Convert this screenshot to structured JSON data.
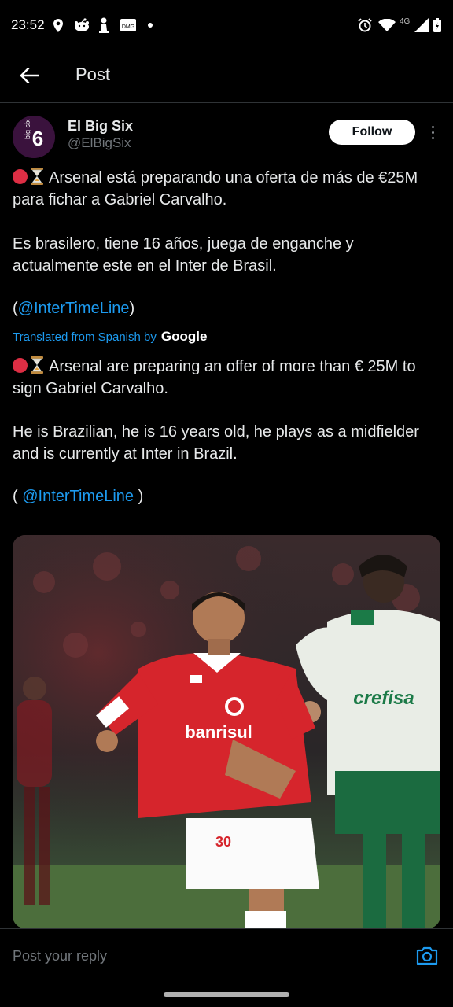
{
  "status_bar": {
    "time": "23:52",
    "network_label": "4G",
    "icons": [
      "location-icon",
      "reddit-icon",
      "chess-pawn-icon",
      "news-app-icon",
      "dot-icon",
      "alarm-icon",
      "wifi-icon",
      "signal-icon",
      "battery-icon"
    ]
  },
  "header": {
    "title": "Post",
    "back_icon": "arrow-left-icon"
  },
  "author": {
    "name": "El Big Six",
    "handle": "@ElBigSix",
    "avatar_text": "big six 6",
    "follow_label": "Follow",
    "more_icon": "more-vertical-icon"
  },
  "post": {
    "original_lines": {
      "p1": "Arsenal está preparando una oferta de más de €25M para fichar a Gabriel Carvalho.",
      "p2": "Es brasilero, tiene 16 años, juega de enganche y actualmente este en el Inter de Brasil.",
      "p3_open": "(",
      "p3_link": "@InterTimeLine",
      "p3_close": ")"
    },
    "translation_label": "Translated from Spanish by",
    "translation_provider": "Google",
    "translated_lines": {
      "p1": "Arsenal are preparing an offer of more than € 25M to sign Gabriel Carvalho.",
      "p2": "He is Brazilian, he is 16 years old, he plays as a midfielder and is currently at Inter in Brazil.",
      "p3_open": "( ",
      "p3_link": "@InterTimeLine",
      "p3_close": " )"
    },
    "emoji": [
      "red-circle-emoji",
      "hourglass-emoji"
    ],
    "media": {
      "type": "photo",
      "shirt_sponsor": "banrisul",
      "opponent_sponsor": "crefisa"
    }
  },
  "reply": {
    "placeholder": "Post your reply",
    "camera_icon": "camera-icon"
  },
  "colors": {
    "background": "#000000",
    "text": "#e7e9ea",
    "muted": "#71767b",
    "link": "#1d9bf0",
    "divider": "#2f3336",
    "follow_bg": "#ffffff"
  }
}
